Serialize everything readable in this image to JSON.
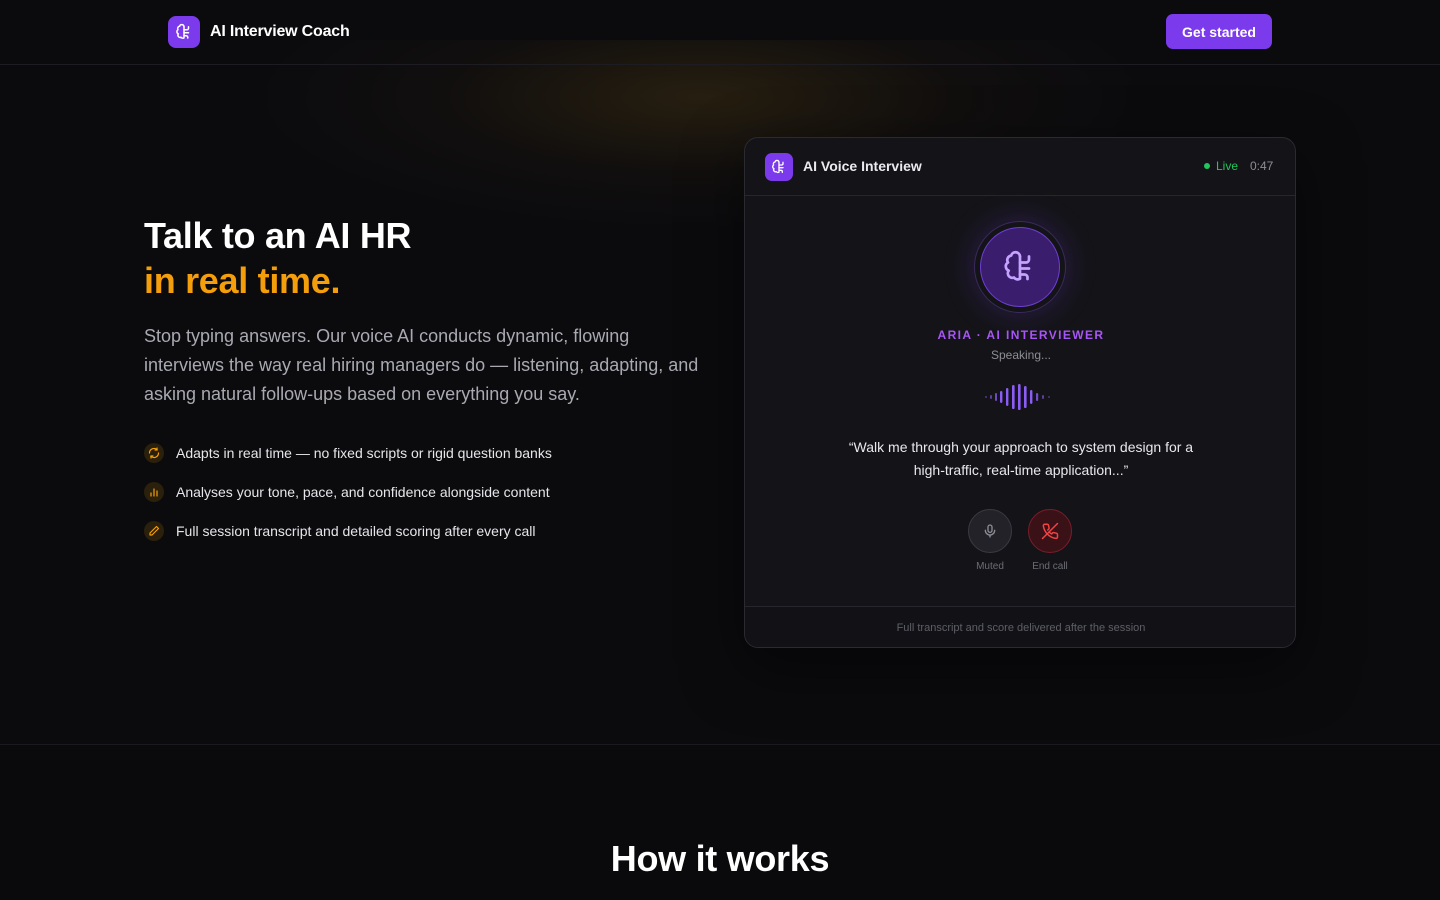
{
  "nav": {
    "brand_name": "AI Interview Coach",
    "cta_label": "Get started"
  },
  "hero": {
    "title_line1": "Talk to an AI HR",
    "title_line2": "in real time.",
    "description": "Stop typing answers. Our voice AI conducts dynamic, flowing interviews the way real hiring managers do — listening, adapting, and asking natural follow-ups based on everything you say.",
    "features": [
      {
        "icon": "refresh-icon",
        "text": "Adapts in real time — no fixed scripts or rigid question banks"
      },
      {
        "icon": "bar-chart-icon",
        "text": "Analyses your tone, pace, and confidence alongside content"
      },
      {
        "icon": "pen-icon",
        "text": "Full session transcript and detailed scoring after every call"
      }
    ]
  },
  "card": {
    "title": "AI Voice Interview",
    "live_label": "Live",
    "timer": "0:47",
    "interviewer_label": "ARIA · AI INTERVIEWER",
    "status": "Speaking...",
    "quote": "“Walk me through your approach to system design for a high-traffic, real-time application...”",
    "mute_label": "Muted",
    "end_label": "End call",
    "footer": "Full transcript and score delivered after the session"
  },
  "section2": {
    "title": "How it works"
  },
  "colors": {
    "accent_purple": "#7c3aed",
    "accent_orange": "#f59e0b",
    "live_green": "#22c55e",
    "end_red": "#ef4444",
    "background": "#0b0b0e"
  }
}
